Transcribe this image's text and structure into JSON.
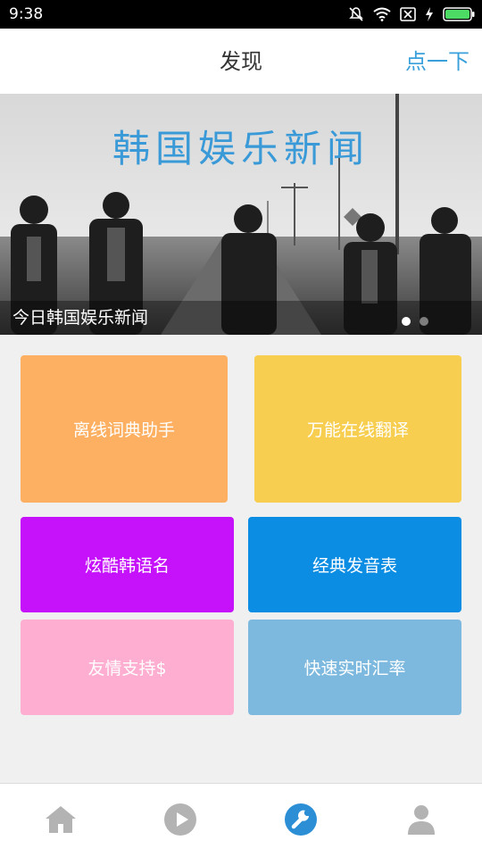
{
  "status_bar": {
    "time": "9:38",
    "icons": [
      "mute-icon",
      "wifi-icon",
      "sim-off-icon",
      "charging-icon",
      "battery-icon"
    ],
    "battery_color": "#4cd964"
  },
  "header": {
    "title": "发现",
    "action_label": "点一下",
    "action_color": "#3aa0dc"
  },
  "banner": {
    "overlay_title": "韩国娱乐新闻",
    "caption": "今日韩国娱乐新闻",
    "slide_count": 2,
    "active_slide": 1
  },
  "tiles": [
    {
      "label": "离线词典助手",
      "color": "#fdb062"
    },
    {
      "label": "万能在线翻译",
      "color": "#f7ce4f"
    },
    {
      "label": "炫酷韩语名",
      "color": "#c611fb"
    },
    {
      "label": "经典发音表",
      "color": "#0b8de4"
    },
    {
      "label": "友情支持$",
      "color": "#fdaed1"
    },
    {
      "label": "快速实时汇率",
      "color": "#7db9de"
    }
  ],
  "bottom_nav": {
    "items": [
      {
        "name": "home",
        "icon": "home-icon",
        "active": false
      },
      {
        "name": "play",
        "icon": "play-icon",
        "active": false
      },
      {
        "name": "tools",
        "icon": "wrench-icon",
        "active": true
      },
      {
        "name": "profile",
        "icon": "person-icon",
        "active": false
      }
    ],
    "active_color": "#2c8fd6",
    "inactive_color": "#b3b3b3"
  }
}
